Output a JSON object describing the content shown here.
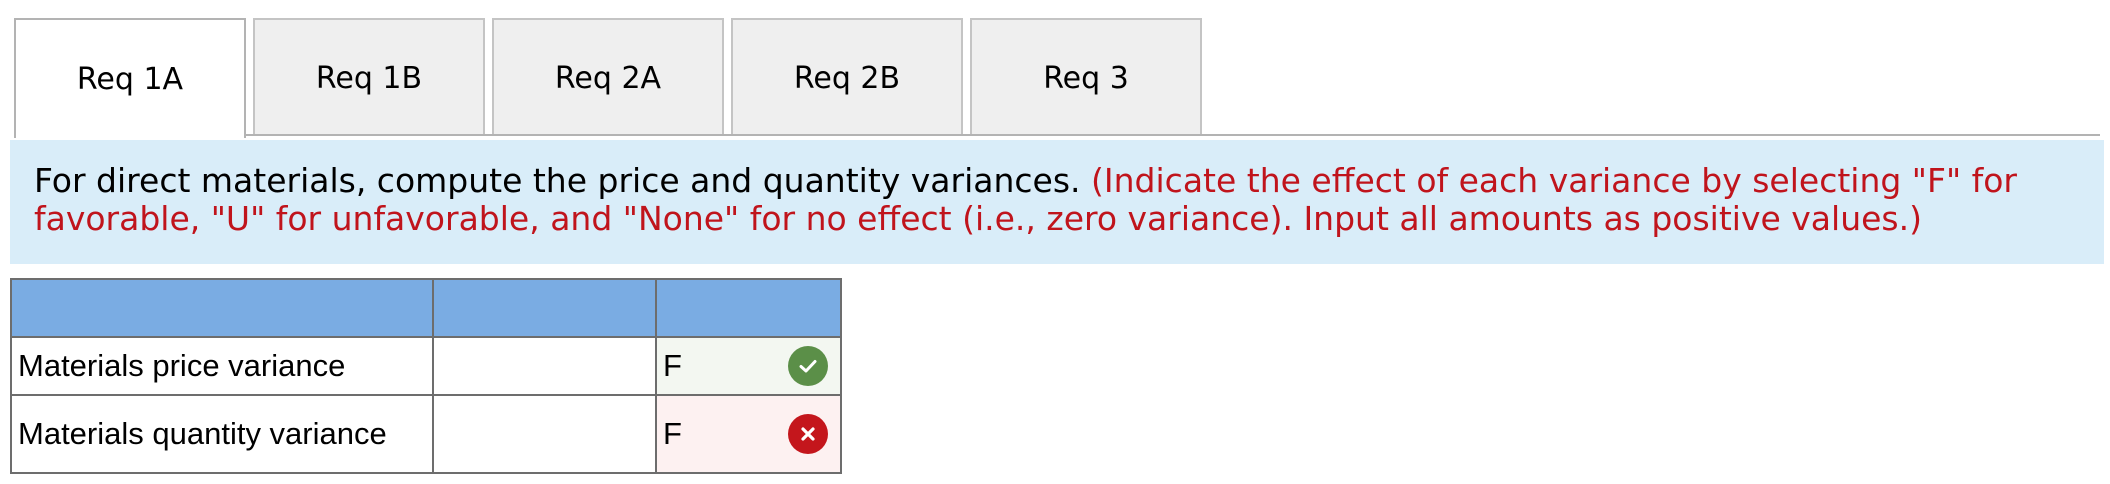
{
  "tabs": [
    {
      "label": "Req 1A",
      "active": true
    },
    {
      "label": "Req 1B",
      "active": false
    },
    {
      "label": "Req 2A",
      "active": false
    },
    {
      "label": "Req 2B",
      "active": false
    },
    {
      "label": "Req 3",
      "active": false
    }
  ],
  "instructions": {
    "main_text": "For direct materials, compute the price and quantity variances.",
    "note_text": "(Indicate the effect of each variance by selecting \"F\" for favorable, \"U\" for unfavorable, and \"None\" for no effect (i.e., zero variance). Input all amounts as positive values.)",
    "note_color": "#c0141c",
    "background": "#d9edf9"
  },
  "table": {
    "header_color": "#7aace3",
    "rows": [
      {
        "label": "Materials price variance",
        "amount": "",
        "effect": "F",
        "status": "correct",
        "status_icon": "check-icon"
      },
      {
        "label": "Materials quantity variance",
        "amount": "",
        "effect": "F",
        "status": "incorrect",
        "status_icon": "cross-icon"
      }
    ]
  }
}
